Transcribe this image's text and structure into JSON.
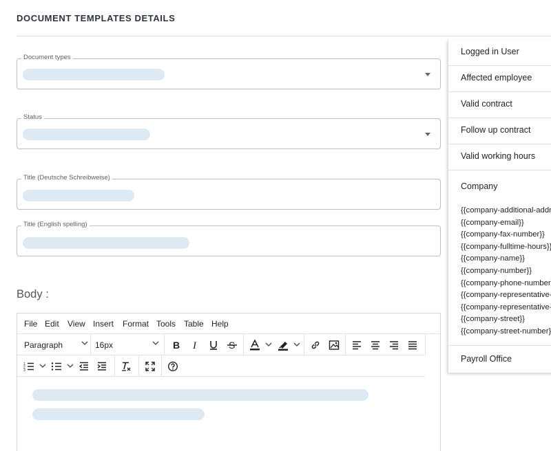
{
  "page": {
    "title": "DOCUMENT TEMPLATES DETAILS"
  },
  "form": {
    "document_types_label": "Document types",
    "status_label": "Status",
    "title_de_label": "Title (Deutsche Schreibweise)",
    "title_en_label": "Title (English spelling)",
    "body_label": "Body :"
  },
  "editor": {
    "menu": [
      "File",
      "Edit",
      "View",
      "Insert",
      "Format",
      "Tools",
      "Table",
      "Help"
    ],
    "block_format": "Paragraph",
    "font_size": "16px",
    "toolbar_icons": [
      "bold-icon",
      "italic-icon",
      "underline-icon",
      "strikethrough-icon",
      "text-color-icon",
      "highlight-icon",
      "link-icon",
      "image-icon",
      "align-left-icon",
      "align-center-icon",
      "align-right-icon",
      "align-justify-icon",
      "numbered-list-icon",
      "bullet-list-icon",
      "outdent-icon",
      "indent-icon",
      "clear-format-icon",
      "fullscreen-icon",
      "help-icon"
    ]
  },
  "placeholders_panel": {
    "items": [
      "Logged in User",
      "Affected employee",
      "Valid contract",
      "Follow up contract",
      "Valid working hours",
      "Company",
      "Payroll Office"
    ],
    "company_placeholders": [
      "{{company-additional-address}}",
      "{{company-email}}",
      "{{company-fax-number}}",
      "{{company-fulltime-hours}}",
      "{{company-name}}",
      "{{company-number}}",
      "{{company-phone-number}}",
      "{{company-representative-",
      "{{company-representative-",
      "{{company-street}}",
      "{{company-street-number}}"
    ]
  },
  "colors": {
    "skeleton": "#deeaf3",
    "border": "#bdbdbd",
    "title": "#2f3340"
  }
}
